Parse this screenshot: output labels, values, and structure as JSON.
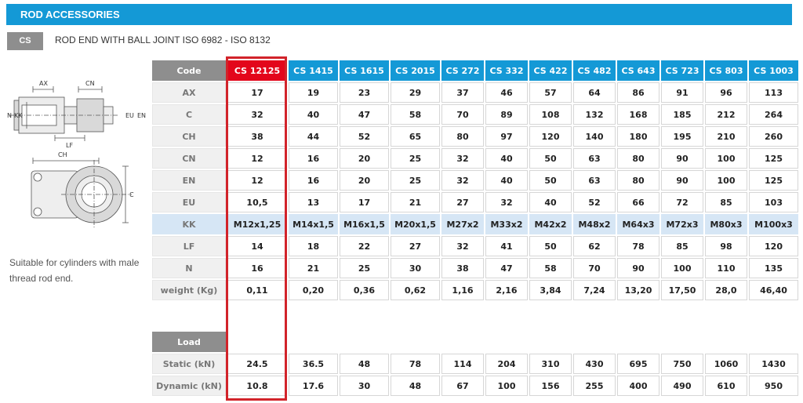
{
  "header": {
    "title": "ROD ACCESSORIES"
  },
  "product": {
    "code_badge": "CS",
    "title": "ROD END WITH BALL JOINT ISO 6982 - ISO 8132",
    "note": "Suitable for cylinders with male thread rod end."
  },
  "drawing_labels": {
    "ax": "AX",
    "cn": "CN",
    "n": "N",
    "kk": "KK",
    "eu": "EU",
    "en": "EN",
    "lf": "LF",
    "ch": "CH",
    "c": "C"
  },
  "table": {
    "code_label": "Code",
    "selected_column": 0,
    "columns": [
      "CS 12125",
      "CS 1415",
      "CS 1615",
      "CS 2015",
      "CS 272",
      "CS 332",
      "CS 422",
      "CS 482",
      "CS 643",
      "CS 723",
      "CS 803",
      "CS 1003"
    ],
    "rows": [
      {
        "label": "AX",
        "values": [
          "17",
          "19",
          "23",
          "29",
          "37",
          "46",
          "57",
          "64",
          "86",
          "91",
          "96",
          "113"
        ]
      },
      {
        "label": "C",
        "values": [
          "32",
          "40",
          "47",
          "58",
          "70",
          "89",
          "108",
          "132",
          "168",
          "185",
          "212",
          "264"
        ]
      },
      {
        "label": "CH",
        "values": [
          "38",
          "44",
          "52",
          "65",
          "80",
          "97",
          "120",
          "140",
          "180",
          "195",
          "210",
          "260"
        ]
      },
      {
        "label": "CN",
        "values": [
          "12",
          "16",
          "20",
          "25",
          "32",
          "40",
          "50",
          "63",
          "80",
          "90",
          "100",
          "125"
        ]
      },
      {
        "label": "EN",
        "values": [
          "12",
          "16",
          "20",
          "25",
          "32",
          "40",
          "50",
          "63",
          "80",
          "90",
          "100",
          "125"
        ]
      },
      {
        "label": "EU",
        "values": [
          "10,5",
          "13",
          "17",
          "21",
          "27",
          "32",
          "40",
          "52",
          "66",
          "72",
          "85",
          "103"
        ]
      },
      {
        "label": "KK",
        "highlight": true,
        "values": [
          "M12x1,25",
          "M14x1,5",
          "M16x1,5",
          "M20x1,5",
          "M27x2",
          "M33x2",
          "M42x2",
          "M48x2",
          "M64x3",
          "M72x3",
          "M80x3",
          "M100x3"
        ]
      },
      {
        "label": "LF",
        "values": [
          "14",
          "18",
          "22",
          "27",
          "32",
          "41",
          "50",
          "62",
          "78",
          "85",
          "98",
          "120"
        ]
      },
      {
        "label": "N",
        "values": [
          "16",
          "21",
          "25",
          "30",
          "38",
          "47",
          "58",
          "70",
          "90",
          "100",
          "110",
          "135"
        ]
      },
      {
        "label": "weight (Kg)",
        "values": [
          "0,11",
          "0,20",
          "0,36",
          "0,62",
          "1,16",
          "2,16",
          "3,84",
          "7,24",
          "13,20",
          "17,50",
          "28,0",
          "46,40"
        ]
      }
    ],
    "load_label": "Load",
    "load_rows": [
      {
        "label": "Static (kN)",
        "values": [
          "24.5",
          "36.5",
          "48",
          "78",
          "114",
          "204",
          "310",
          "430",
          "695",
          "750",
          "1060",
          "1430"
        ]
      },
      {
        "label": "Dynamic (kN)",
        "values": [
          "10.8",
          "17.6",
          "30",
          "48",
          "67",
          "100",
          "156",
          "255",
          "400",
          "490",
          "610",
          "950"
        ]
      }
    ]
  }
}
